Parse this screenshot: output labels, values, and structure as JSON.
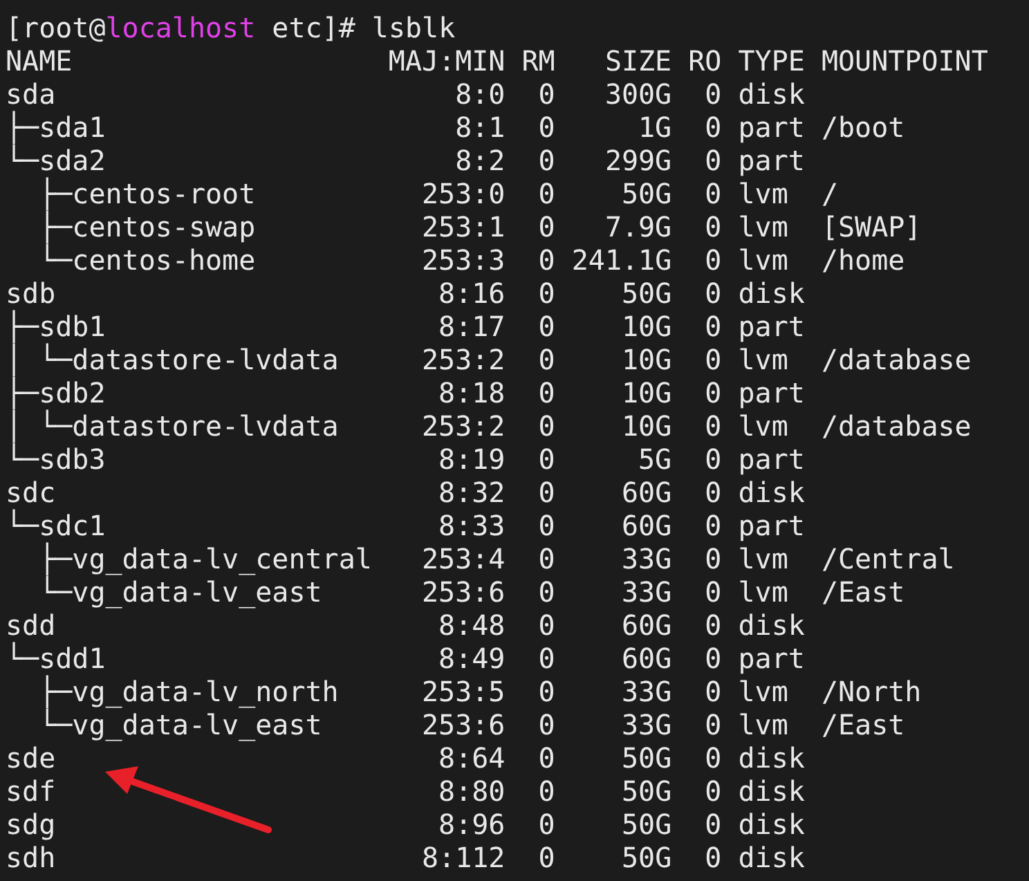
{
  "prompt": {
    "before": "[root@",
    "hostname": "localhost",
    "after": " etc]#",
    "command": "lsblk"
  },
  "columns": [
    "NAME",
    "MAJ:MIN",
    "RM",
    "SIZE",
    "RO",
    "TYPE",
    "MOUNTPOINT"
  ],
  "devices": [
    {
      "name": "sda",
      "maj_min": "8:0",
      "rm": "0",
      "size": "300G",
      "ro": "0",
      "type": "disk",
      "children": [
        {
          "prefix": "├─",
          "name": "sda1",
          "maj_min": "8:1",
          "rm": "0",
          "size": "1G",
          "ro": "0",
          "type": "part",
          "mountpoint": "/boot"
        },
        {
          "prefix": "└─",
          "name": "sda2",
          "maj_min": "8:2",
          "rm": "0",
          "size": "299G",
          "ro": "0",
          "type": "part",
          "children": [
            {
              "prefix": "  ├─",
              "name": "centos-root",
              "maj_min": "253:0",
              "rm": "0",
              "size": "50G",
              "ro": "0",
              "type": "lvm",
              "mountpoint": "/"
            },
            {
              "prefix": "  ├─",
              "name": "centos-swap",
              "maj_min": "253:1",
              "rm": "0",
              "size": "7.9G",
              "ro": "0",
              "type": "lvm",
              "mountpoint": "[SWAP]"
            },
            {
              "prefix": "  └─",
              "name": "centos-home",
              "maj_min": "253:3",
              "rm": "0",
              "size": "241.1G",
              "ro": "0",
              "type": "lvm",
              "mountpoint": "/home"
            }
          ]
        }
      ]
    },
    {
      "name": "sdb",
      "maj_min": "8:16",
      "rm": "0",
      "size": "50G",
      "ro": "0",
      "type": "disk",
      "children": [
        {
          "prefix": "├─",
          "name": "sdb1",
          "maj_min": "8:17",
          "rm": "0",
          "size": "10G",
          "ro": "0",
          "type": "part",
          "children": [
            {
              "prefix": "│ └─",
              "name": "datastore-lvdata",
              "maj_min": "253:2",
              "rm": "0",
              "size": "10G",
              "ro": "0",
              "type": "lvm",
              "mountpoint": "/database"
            }
          ]
        },
        {
          "prefix": "├─",
          "name": "sdb2",
          "maj_min": "8:18",
          "rm": "0",
          "size": "10G",
          "ro": "0",
          "type": "part",
          "children": [
            {
              "prefix": "│ └─",
              "name": "datastore-lvdata",
              "maj_min": "253:2",
              "rm": "0",
              "size": "10G",
              "ro": "0",
              "type": "lvm",
              "mountpoint": "/database"
            }
          ]
        },
        {
          "prefix": "└─",
          "name": "sdb3",
          "maj_min": "8:19",
          "rm": "0",
          "size": "5G",
          "ro": "0",
          "type": "part"
        }
      ]
    },
    {
      "name": "sdc",
      "maj_min": "8:32",
      "rm": "0",
      "size": "60G",
      "ro": "0",
      "type": "disk",
      "children": [
        {
          "prefix": "└─",
          "name": "sdc1",
          "maj_min": "8:33",
          "rm": "0",
          "size": "60G",
          "ro": "0",
          "type": "part",
          "children": [
            {
              "prefix": "  ├─",
              "name": "vg_data-lv_central",
              "maj_min": "253:4",
              "rm": "0",
              "size": "33G",
              "ro": "0",
              "type": "lvm",
              "mountpoint": "/Central"
            },
            {
              "prefix": "  └─",
              "name": "vg_data-lv_east",
              "maj_min": "253:6",
              "rm": "0",
              "size": "33G",
              "ro": "0",
              "type": "lvm",
              "mountpoint": "/East"
            }
          ]
        }
      ]
    },
    {
      "name": "sdd",
      "maj_min": "8:48",
      "rm": "0",
      "size": "60G",
      "ro": "0",
      "type": "disk",
      "children": [
        {
          "prefix": "└─",
          "name": "sdd1",
          "maj_min": "8:49",
          "rm": "0",
          "size": "60G",
          "ro": "0",
          "type": "part",
          "children": [
            {
              "prefix": "  ├─",
              "name": "vg_data-lv_north",
              "maj_min": "253:5",
              "rm": "0",
              "size": "33G",
              "ro": "0",
              "type": "lvm",
              "mountpoint": "/North"
            },
            {
              "prefix": "  └─",
              "name": "vg_data-lv_east",
              "maj_min": "253:6",
              "rm": "0",
              "size": "33G",
              "ro": "0",
              "type": "lvm",
              "mountpoint": "/East"
            }
          ]
        }
      ]
    },
    {
      "name": "sde",
      "maj_min": "8:64",
      "rm": "0",
      "size": "50G",
      "ro": "0",
      "type": "disk"
    },
    {
      "name": "sdf",
      "maj_min": "8:80",
      "rm": "0",
      "size": "50G",
      "ro": "0",
      "type": "disk"
    },
    {
      "name": "sdg",
      "maj_min": "8:96",
      "rm": "0",
      "size": "50G",
      "ro": "0",
      "type": "disk"
    },
    {
      "name": "sdh",
      "maj_min": "8:112",
      "rm": "0",
      "size": "50G",
      "ro": "0",
      "type": "disk"
    }
  ]
}
